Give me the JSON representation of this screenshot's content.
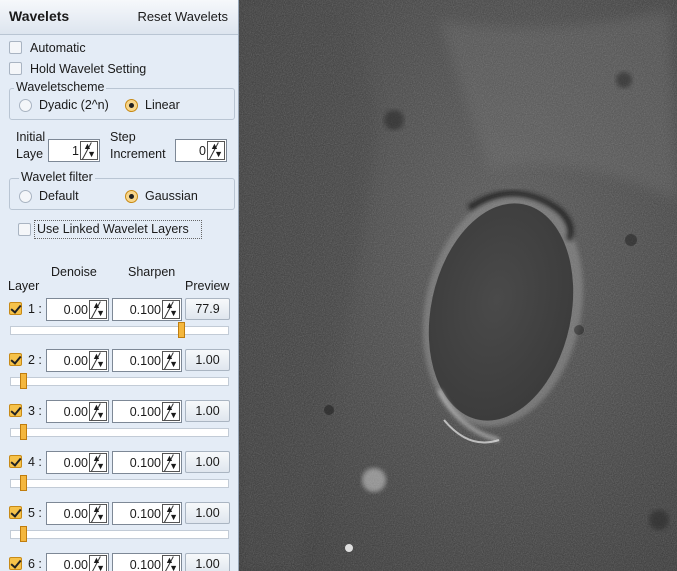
{
  "panel": {
    "title": "Wavelets",
    "reset_label": "Reset Wavelets",
    "automatic_label": "Automatic",
    "hold_label": "Hold Wavelet Setting",
    "scheme": {
      "legend": "Waveletscheme",
      "dyadic": "Dyadic (2^n)",
      "linear": "Linear",
      "selected": "Linear"
    },
    "initial_layer": {
      "label1": "Initial",
      "label2": "Laye",
      "value": "1"
    },
    "step_increment": {
      "label1": "Step",
      "label2": "Increment",
      "value": "0"
    },
    "filter": {
      "legend": "Wavelet filter",
      "default": "Default",
      "gaussian": "Gaussian",
      "selected": "Gaussian"
    },
    "linked_label": "Use Linked Wavelet Layers",
    "headers": {
      "layer": "Layer",
      "denoise": "Denoise",
      "sharpen": "Sharpen",
      "preview": "Preview"
    },
    "layers": [
      {
        "label": "1 :",
        "denoise": "0.00",
        "sharpen": "0.100",
        "preview": "77.9",
        "slider": 1.0,
        "checked": true
      },
      {
        "label": "2 :",
        "denoise": "0.00",
        "sharpen": "0.100",
        "preview": "1.00",
        "slider": 0.0,
        "checked": true
      },
      {
        "label": "3 :",
        "denoise": "0.00",
        "sharpen": "0.100",
        "preview": "1.00",
        "slider": 0.0,
        "checked": true
      },
      {
        "label": "4 :",
        "denoise": "0.00",
        "sharpen": "0.100",
        "preview": "1.00",
        "slider": 0.0,
        "checked": true
      },
      {
        "label": "5 :",
        "denoise": "0.00",
        "sharpen": "0.100",
        "preview": "1.00",
        "slider": 0.0,
        "checked": true
      },
      {
        "label": "6 :",
        "denoise": "0.00",
        "sharpen": "0.100",
        "preview": "1.00",
        "slider": 0.0,
        "checked": true
      }
    ]
  },
  "image": {
    "subject": "lunar surface with crater"
  }
}
